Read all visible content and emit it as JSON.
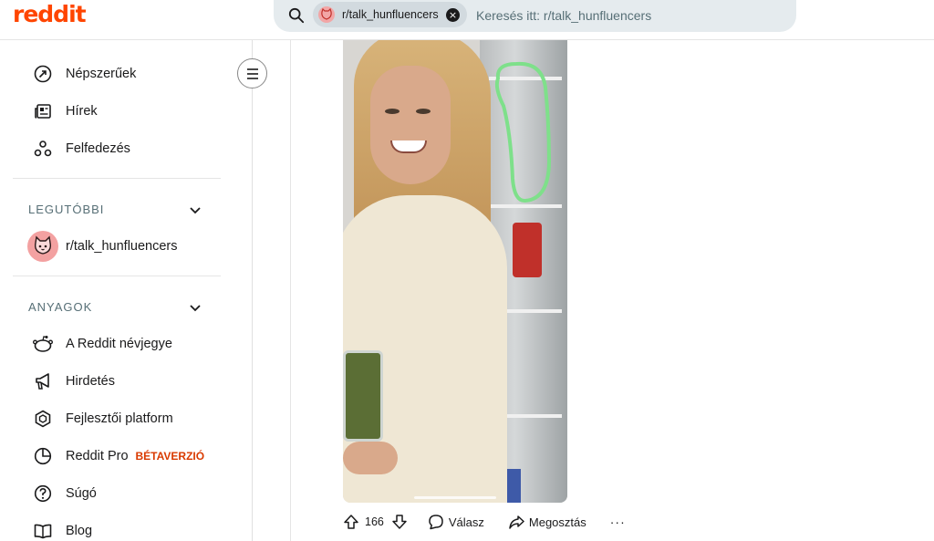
{
  "brand": {
    "logo_text": "reddit",
    "color": "#ff4500"
  },
  "search": {
    "chip_label": "r/talk_hunfluencers",
    "placeholder": "Keresés itt: r/talk_hunfluencers",
    "icon": "search-icon",
    "clear_icon": "close-icon"
  },
  "sidebar": {
    "main_items": [
      {
        "label": "Népszerűek",
        "icon": "trending-icon"
      },
      {
        "label": "Hírek",
        "icon": "news-icon"
      },
      {
        "label": "Felfedezés",
        "icon": "explore-icon"
      }
    ],
    "recent": {
      "heading": "LEGUTÓBBI",
      "items": [
        {
          "label": "r/talk_hunfluencers",
          "icon": "cat-avatar-icon"
        }
      ]
    },
    "resources": {
      "heading": "ANYAGOK",
      "items": [
        {
          "label": "A Reddit névjegye",
          "icon": "reddit-alien-icon"
        },
        {
          "label": "Hirdetés",
          "icon": "megaphone-icon"
        },
        {
          "label": "Fejlesztői platform",
          "icon": "hexagon-icon"
        },
        {
          "label": "Reddit Pro",
          "icon": "pie-chart-icon",
          "badge": "BÉTAVERZIÓ"
        },
        {
          "label": "Súgó",
          "icon": "help-icon"
        },
        {
          "label": "Blog",
          "icon": "book-icon"
        }
      ]
    }
  },
  "post": {
    "votes": "166",
    "reply_label": "Válasz",
    "share_label": "Megosztás",
    "more_label": "···",
    "highlight_color": "#7ee08a",
    "accent_beta_color": "#d93a00"
  }
}
